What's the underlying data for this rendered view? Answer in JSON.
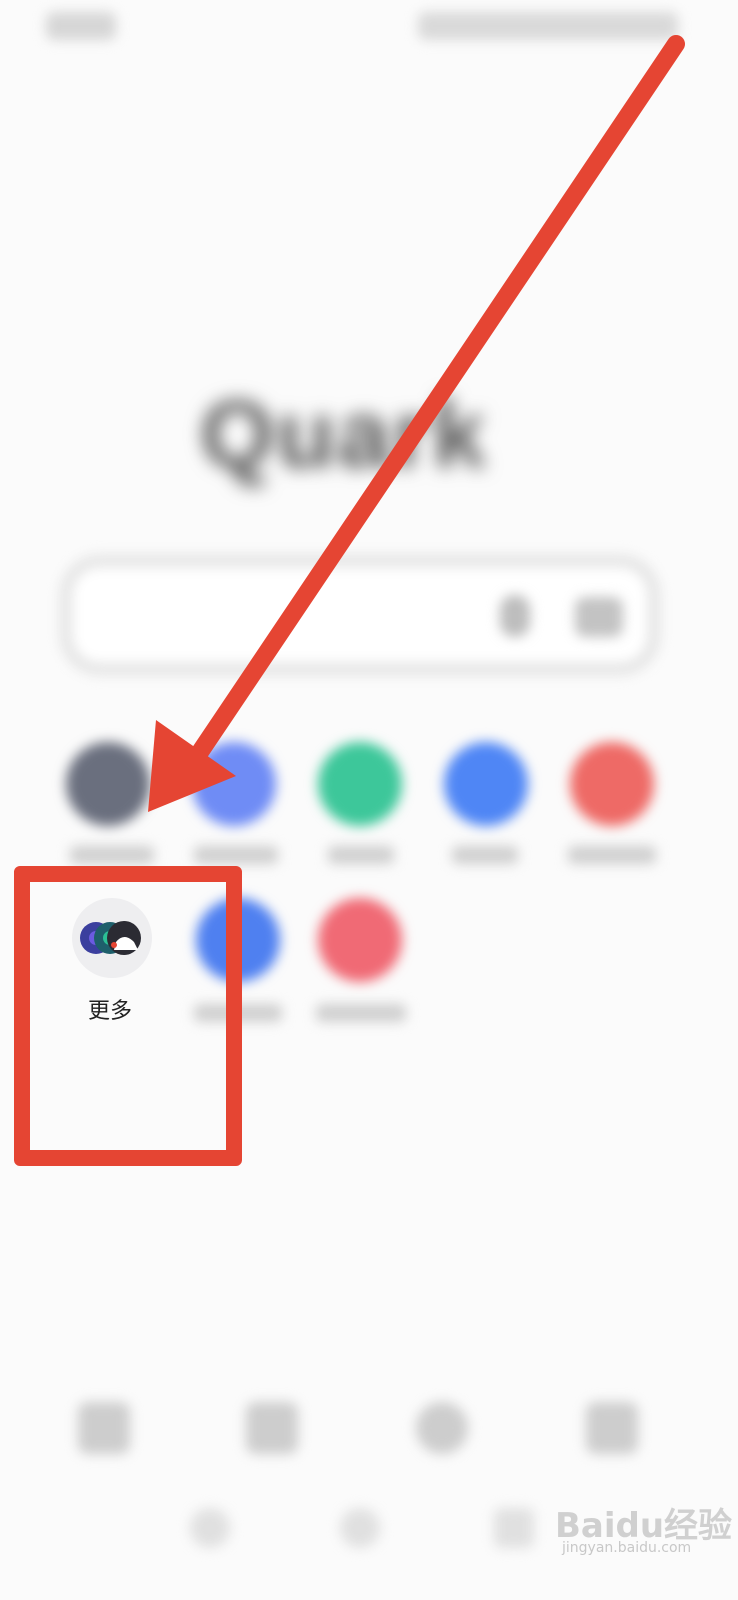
{
  "app": {
    "logo_text": "Quark"
  },
  "shortcuts": {
    "more_label": "更多"
  },
  "annotation": {
    "color": "#e54533"
  },
  "watermark": {
    "brand": "Baidu经验",
    "url": "jingyan.baidu.com"
  }
}
